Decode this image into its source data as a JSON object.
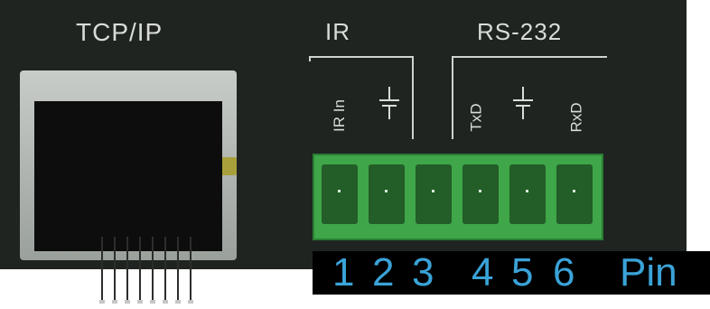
{
  "labels": {
    "tcp": "TCP/IP",
    "ir": "IR",
    "rs232": "RS-232",
    "ir_in": "IR In",
    "txd": "TxD",
    "rxd": "RxD"
  },
  "pin_numbers": [
    "1",
    "2",
    "3",
    "4",
    "5",
    "6"
  ],
  "pin_word": "Pin",
  "colors": {
    "panel": "#1f2421",
    "terminal_green": "#3fa64a",
    "pin_text": "#3aa3d8"
  }
}
